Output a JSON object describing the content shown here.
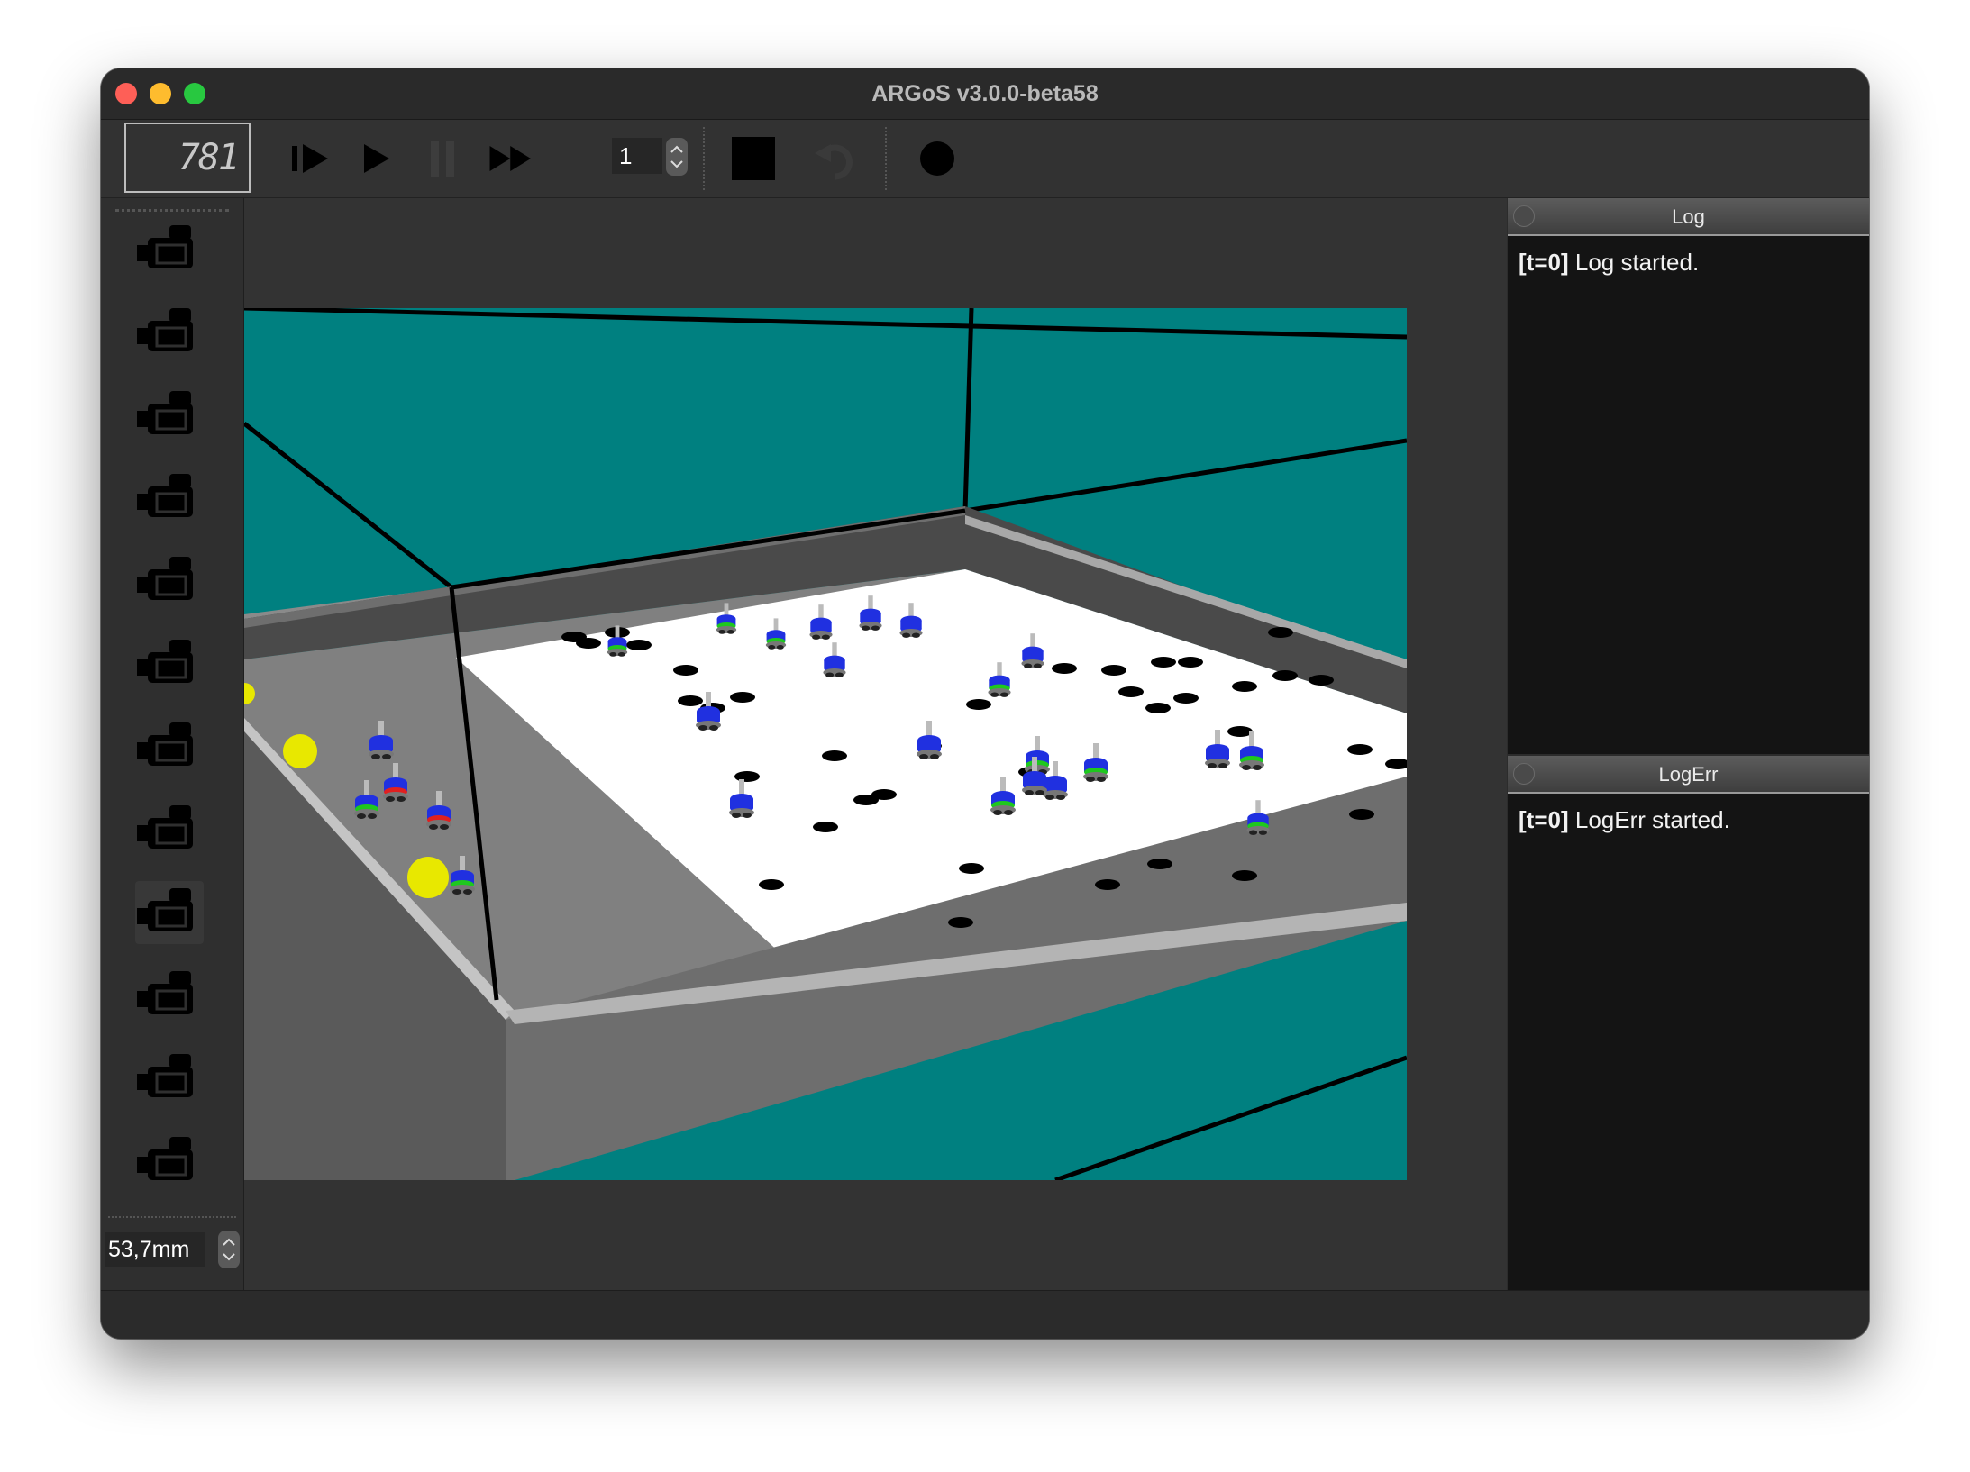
{
  "window": {
    "title": "ARGoS v3.0.0-beta58"
  },
  "toolbar": {
    "step_counter": "781",
    "speed_value": "1",
    "icons": [
      "step-icon",
      "play-icon",
      "pause-icon",
      "fast-forward-icon",
      "stop-icon",
      "reset-icon",
      "record-icon"
    ]
  },
  "sidebar": {
    "camera_count": 12,
    "active_camera_index": 8,
    "zoom_value": "53,7mm",
    "icon": "camera-icon"
  },
  "log": {
    "title": "Log",
    "tag": "[t=0]",
    "message": "Log started."
  },
  "logerr": {
    "title": "LogErr",
    "tag": "[t=0]",
    "message": "LogErr started."
  },
  "colors": {
    "background_sky": "#008080",
    "arena_floor": "#ffffff",
    "nest_area": "#808080",
    "food_item": "#ffff00",
    "robot_led_green": "#1ec81e",
    "robot_led_red": "#e02020",
    "robot_led_blue": "#2030e0"
  }
}
